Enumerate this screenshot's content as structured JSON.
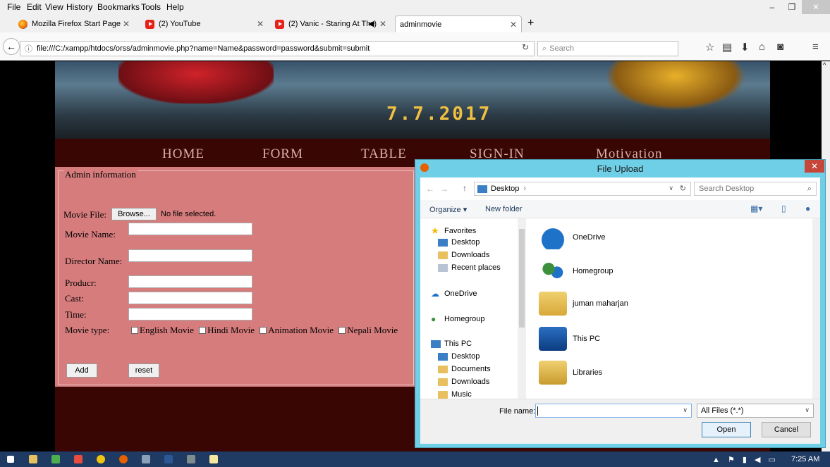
{
  "menu": [
    "File",
    "Edit",
    "View",
    "History",
    "Bookmarks",
    "Tools",
    "Help"
  ],
  "tabs": [
    {
      "label": "Mozilla Firefox Start Page",
      "icon": "firefox-icon"
    },
    {
      "label": "(2) YouTube",
      "icon": "youtube-icon"
    },
    {
      "label": "(2) Vanic - Staring At The",
      "icon": "youtube-icon"
    },
    {
      "label": "adminmovie",
      "icon": ""
    }
  ],
  "new_tab": "+",
  "url": "file:///C:/xampp/htdocs/orss/adminmovie.php?name=Name&password=password&submit=submit",
  "search_placeholder": "Search",
  "banner": {
    "date": "7.7.2017"
  },
  "site_nav": [
    "HOME",
    "FORM",
    "TABLE",
    "SIGN-IN",
    "Motivation"
  ],
  "form": {
    "legend": "Admin information",
    "movie_file_label": "Movie File:",
    "browse_label": "Browse...",
    "no_file": "No file selected.",
    "movie_name_label": "Movie Name:",
    "director_label": "Director Name:",
    "producer_label": "Producr:",
    "cast_label": "Cast:",
    "time_label": "Time:",
    "movie_type_label": "Movie type:",
    "types": [
      "English Movie",
      "Hindi Movie",
      "Animation Movie",
      "Nepali Movie"
    ],
    "add_label": "Add",
    "reset_label": "reset"
  },
  "dialog": {
    "title": "File Upload",
    "location": "Desktop",
    "search_placeholder": "Search Desktop",
    "organize": "Organize ▾",
    "new_folder": "New folder",
    "nav": {
      "favorites": "Favorites",
      "fav_items": [
        "Desktop",
        "Downloads",
        "Recent places"
      ],
      "onedrive": "OneDrive",
      "homegroup": "Homegroup",
      "thispc": "This PC",
      "pc_items": [
        "Desktop",
        "Documents",
        "Downloads",
        "Music"
      ]
    },
    "items": [
      "OneDrive",
      "Homegroup",
      "juman maharjan",
      "This PC",
      "Libraries"
    ],
    "file_name_label": "File name:",
    "file_name_value": "",
    "filter": "All Files (*.*)",
    "open_label": "Open",
    "cancel_label": "Cancel"
  },
  "taskbar": {
    "clock": "7:25 AM"
  }
}
